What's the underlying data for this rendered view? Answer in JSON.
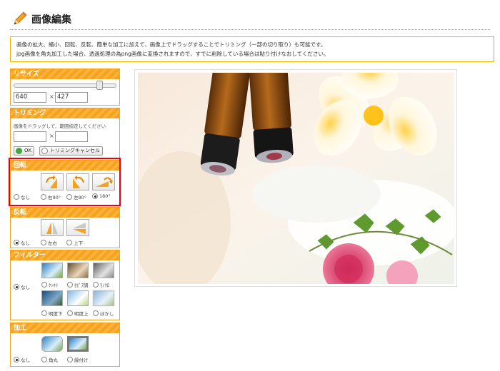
{
  "header": {
    "title": "画像編集",
    "icon": "pencil-icon"
  },
  "notice": {
    "line1": "画像の拡大、縮小、回転、反転、簡単な加工に加えて、画像上でドラッグすることでトリミング（一部の切り取り）も可能です。",
    "line2": "jpg画像を角丸加工した場合、透過処理の為png画像に変換されますので、すでに削除している場合は貼り付けなおしてください。"
  },
  "resize": {
    "title": "リサイズ",
    "width": "640",
    "height": "427",
    "times": "×",
    "slider_level": 0.85
  },
  "trim": {
    "title": "トリミング",
    "hint": "画像をドラッグして、範囲指定してください",
    "width": "",
    "height": "",
    "times": "×",
    "ok_label": "OK",
    "cancel_label": "トリミングキャンセル"
  },
  "rotate": {
    "title": "回転",
    "options": [
      {
        "label": "なし",
        "selected": false
      },
      {
        "label": "右90°",
        "selected": false
      },
      {
        "label": "左90°",
        "selected": false
      },
      {
        "label": "180°",
        "selected": true
      }
    ]
  },
  "flip": {
    "title": "反転",
    "options": [
      {
        "label": "なし",
        "selected": true
      },
      {
        "label": "左右",
        "selected": false
      },
      {
        "label": "上下",
        "selected": false
      }
    ]
  },
  "filter": {
    "title": "フィルター",
    "options": [
      {
        "label": "なし",
        "selected": true
      },
      {
        "label": "ｸｯｷﾘ",
        "selected": false
      },
      {
        "label": "ｾﾋﾟｱ調",
        "selected": false
      },
      {
        "label": "ﾓﾉｸﾛ",
        "selected": false
      },
      {
        "label": "明度下",
        "selected": false
      },
      {
        "label": "明度上",
        "selected": false
      },
      {
        "label": "ぼかし",
        "selected": false
      }
    ]
  },
  "effect": {
    "title": "加工",
    "options": [
      {
        "label": "なし",
        "selected": true
      },
      {
        "label": "角丸",
        "selected": false
      },
      {
        "label": "縁付け",
        "selected": false
      }
    ]
  },
  "colors": {
    "accent": "#f7a21b",
    "highlight": "#e3001b",
    "notice_border": "#f0b400"
  }
}
